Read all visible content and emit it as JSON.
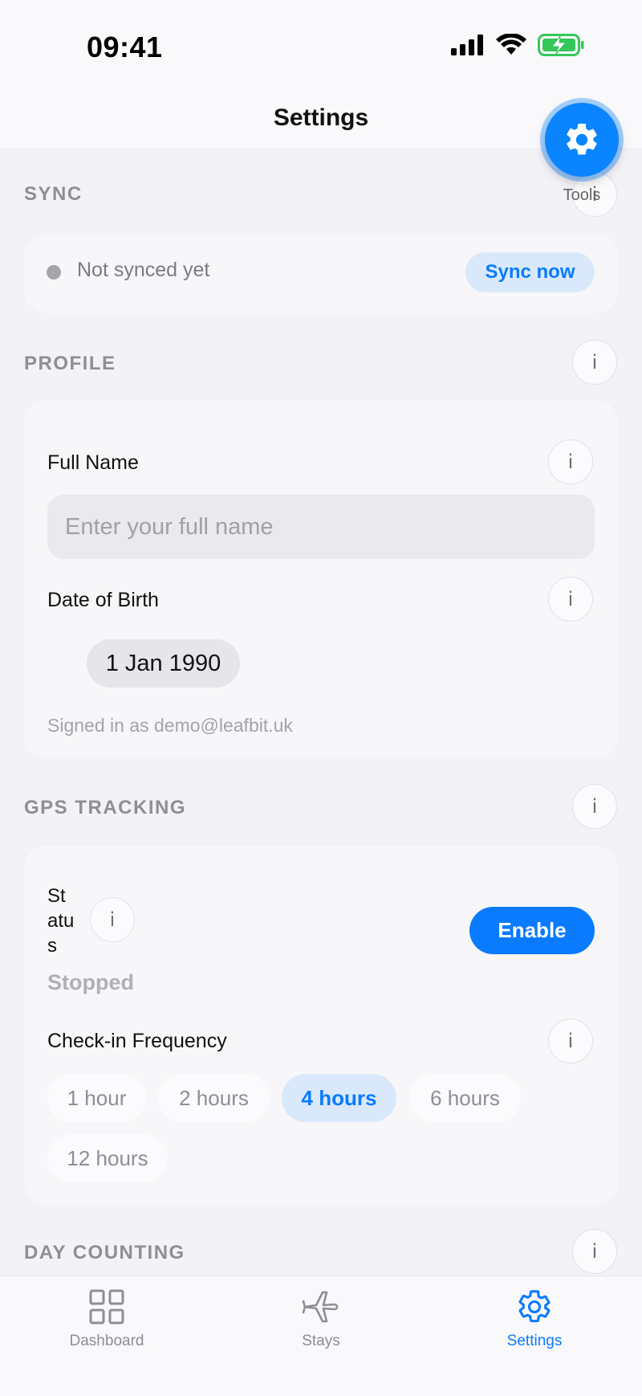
{
  "status_bar": {
    "time": "09:41"
  },
  "nav": {
    "title": "Settings"
  },
  "fab": {
    "label": "Tools"
  },
  "sync": {
    "header": "SYNC",
    "status_text": "Not synced yet",
    "button_label": "Sync now"
  },
  "profile": {
    "header": "PROFILE",
    "full_name_label": "Full Name",
    "full_name_value": "",
    "full_name_placeholder": "Enter your full name",
    "dob_label": "Date of Birth",
    "dob_value": "1 Jan 1990",
    "signed_in_text": "Signed in as demo@leafbit.uk"
  },
  "gps": {
    "header": "GPS TRACKING",
    "status_label": "Status",
    "status_value": "Stopped",
    "enable_label": "Enable",
    "frequency_label": "Check-in Frequency",
    "frequency_options": [
      "1 hour",
      "2 hours",
      "4 hours",
      "6 hours",
      "12 hours"
    ],
    "frequency_selected": "4 hours"
  },
  "day_counting": {
    "header": "DAY COUNTING"
  },
  "info_glyph": "i",
  "tabs": [
    {
      "label": "Dashboard",
      "icon": "grid-icon",
      "active": false
    },
    {
      "label": "Stays",
      "icon": "airplane-icon",
      "active": false
    },
    {
      "label": "Settings",
      "icon": "gear-icon",
      "active": true
    }
  ],
  "colors": {
    "accent": "#0a7bff",
    "accent_light": "#d9e9fb",
    "background": "#f2f2f7"
  }
}
